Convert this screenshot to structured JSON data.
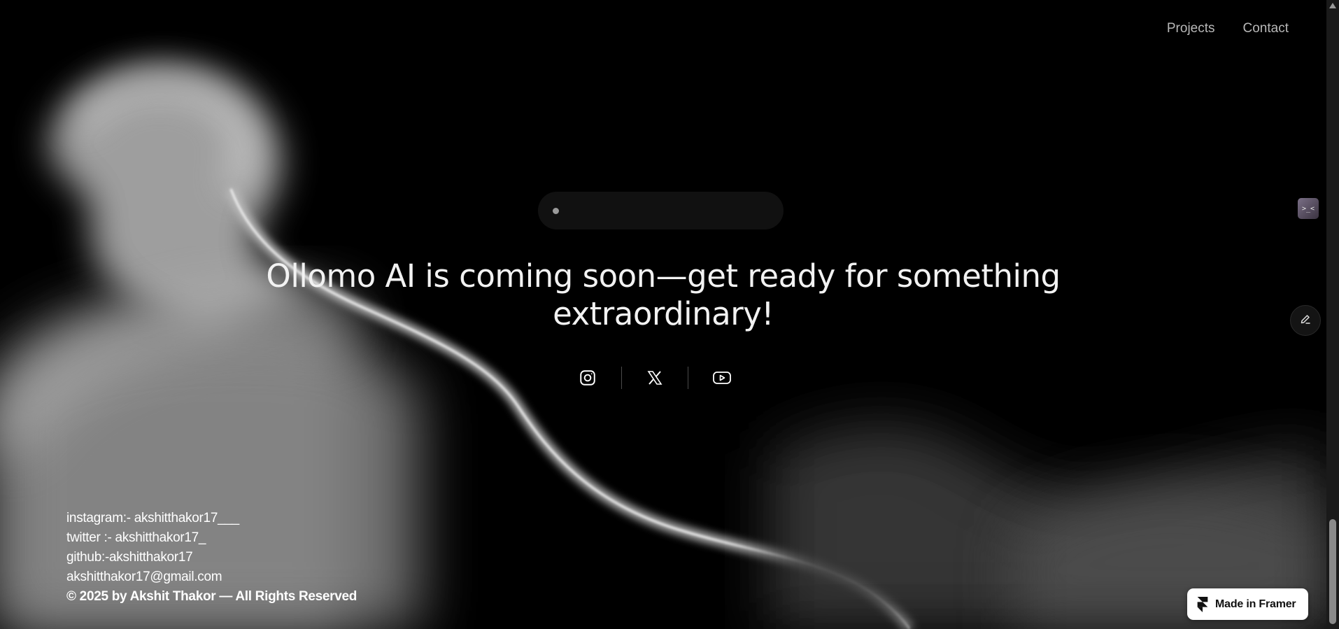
{
  "nav": {
    "items": [
      {
        "label": "Projects"
      },
      {
        "label": "Contact"
      }
    ]
  },
  "hero": {
    "headline": "Ollomo AI is coming soon—get ready for something extraordinary!"
  },
  "socials": [
    {
      "icon": "instagram-icon"
    },
    {
      "icon": "x-twitter-icon"
    },
    {
      "icon": "youtube-icon"
    }
  ],
  "footer": {
    "lines": [
      "instagram:- akshitthakor17___",
      "twitter :- akshitthakor17_",
      "github:-akshitthakor17",
      "akshitthakor17@gmail.com"
    ],
    "copyright": "© 2025 by Akshit Thakor — All Rights Reserved"
  },
  "side_buttons": {
    "top_icon_text": ">_<"
  },
  "badge": {
    "label": "Made in Framer"
  },
  "colors": {
    "background": "#000000",
    "text": "#f2f2f2",
    "nav_text": "#b8b8b8",
    "badge_bg": "#ffffff"
  }
}
